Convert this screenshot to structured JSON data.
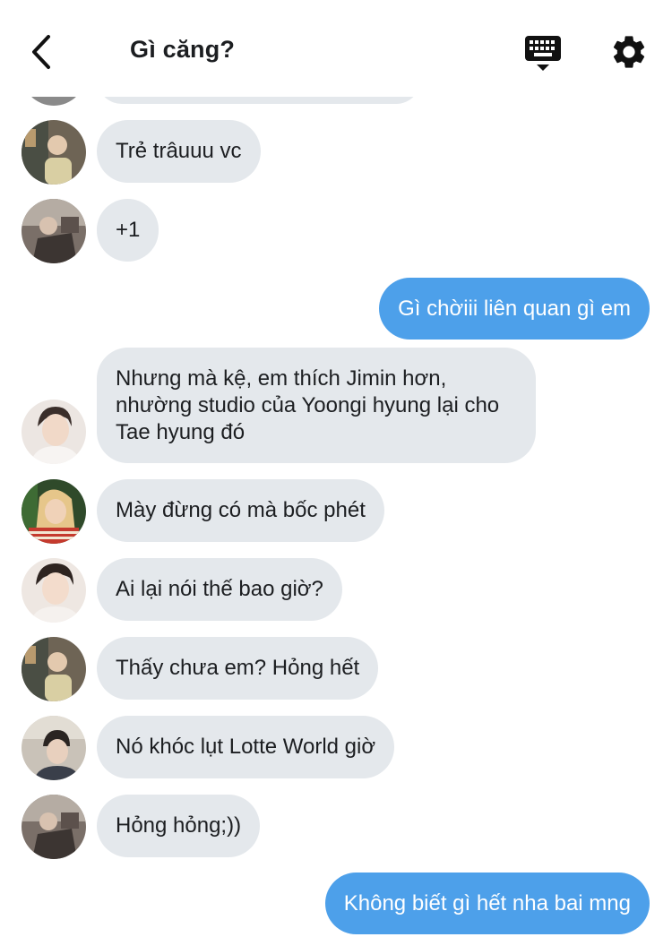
{
  "header": {
    "title": "Gì căng?",
    "back_icon": "chevron-left-icon",
    "keyboard_icon": "keyboard-icon",
    "settings_icon": "gear-icon"
  },
  "messages": [
    {
      "side": "in",
      "avatar": "avatar-1",
      "text": "Trẻ trâuuu vc"
    },
    {
      "side": "in",
      "avatar": "avatar-2",
      "text": "+1"
    },
    {
      "side": "out",
      "text": "Gì chờiii liên quan gì em"
    },
    {
      "side": "in",
      "avatar": "avatar-3",
      "text": "Nhưng mà kệ, em thích Jimin hơn, nhường studio của Yoongi hyung lại cho Tae hyung đó"
    },
    {
      "side": "in",
      "avatar": "avatar-4",
      "text": "Mày đừng có mà bốc phét"
    },
    {
      "side": "in",
      "avatar": "avatar-3",
      "text": "Ai lại nói thế bao giờ?"
    },
    {
      "side": "in",
      "avatar": "avatar-1",
      "text": "Thấy chưa em? Hỏng hết"
    },
    {
      "side": "in",
      "avatar": "avatar-5",
      "text": "Nó khóc lụt Lotte World giờ"
    },
    {
      "side": "in",
      "avatar": "avatar-2",
      "text": "Hỏng hỏng;))"
    },
    {
      "side": "out",
      "text": "Không biết gì hết nha bai mng"
    }
  ],
  "colors": {
    "incoming_bubble": "#e4e8ec",
    "outgoing_bubble": "#4da0ea",
    "background": "#ffffff",
    "icon": "#111111"
  }
}
